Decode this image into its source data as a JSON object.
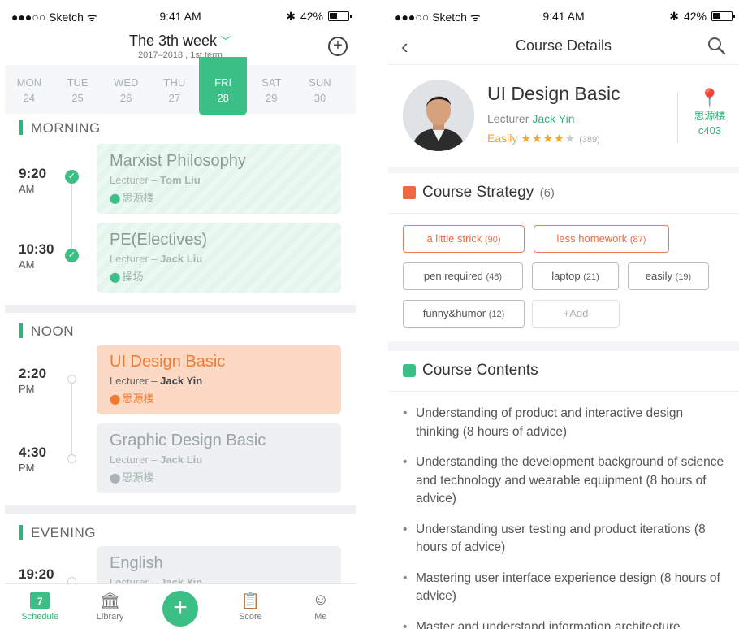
{
  "status": {
    "carrier": "●●●○○ Sketch ᯤ",
    "time": "9:41 AM",
    "bt": "✱",
    "battery": "42%"
  },
  "schedule": {
    "week_title": "The 3th week",
    "term": "2017–2018 , 1st term",
    "days": [
      {
        "d": "MON",
        "n": "24"
      },
      {
        "d": "TUE",
        "n": "25"
      },
      {
        "d": "WED",
        "n": "26"
      },
      {
        "d": "THU",
        "n": "27"
      },
      {
        "d": "FRI",
        "n": "28"
      },
      {
        "d": "SAT",
        "n": "29"
      },
      {
        "d": "SUN",
        "n": "30"
      }
    ],
    "sections": {
      "morning": "MORNING",
      "noon": "NOON",
      "evening": "EVENING"
    },
    "classes": [
      {
        "time": "9:20",
        "ampm": "AM",
        "name": "Marxist Philosophy",
        "lecturer_label": "Lecturer – ",
        "lecturer": "Tom Liu",
        "location": "思源楼"
      },
      {
        "time": "10:30",
        "ampm": "AM",
        "name": "PE(Electives)",
        "lecturer_label": "Lecturer – ",
        "lecturer": "Jack Liu",
        "location": "操场"
      },
      {
        "time": "2:20",
        "ampm": "PM",
        "name": "UI Design Basic",
        "lecturer_label": "Lecturer – ",
        "lecturer": "Jack Yin",
        "location": "思源楼"
      },
      {
        "time": "4:30",
        "ampm": "PM",
        "name": "Graphic Design Basic",
        "lecturer_label": "Lecturer – ",
        "lecturer": "Jack Liu",
        "location": "思源楼"
      },
      {
        "time": "19:20",
        "ampm": "PM",
        "name": "English",
        "lecturer_label": "Lecturer – ",
        "lecturer": "Jack Yin",
        "location": ""
      }
    ],
    "tabs": {
      "schedule": "Schedule",
      "calendar_day": "7",
      "library": "Library",
      "score": "Score",
      "me": "Me"
    }
  },
  "details": {
    "nav_title": "Course Details",
    "course_name": "UI Design Basic",
    "lecturer_label": "Lecturer",
    "lecturer": "Jack Yin",
    "difficulty": "Easily",
    "rating": 4,
    "rating_count": "(389)",
    "building": "思源楼",
    "room": "c403",
    "strategy_title": "Course Strategy",
    "strategy_count": "(6)",
    "tags": [
      {
        "label": "a little strick",
        "count": "(90)"
      },
      {
        "label": "less homework",
        "count": "(87)"
      },
      {
        "label": "pen required",
        "count": "(48)"
      },
      {
        "label": "laptop",
        "count": "(21)"
      },
      {
        "label": "easily",
        "count": "(19)"
      },
      {
        "label": "funny&humor",
        "count": "(12)"
      }
    ],
    "add_tag": "+Add",
    "contents_title": "Course Contents",
    "contents": [
      "Understanding of product and interactive design thinking (8 hours of advice)",
      "Understanding the development background of science and technology and wearable equipment (8 hours of advice)",
      "Understanding user testing and product iterations (8 hours of advice)",
      "Mastering user interface experience design (8 hours of advice)",
      "Master and understand information architecture"
    ]
  },
  "colors": {
    "accent": "#3cbf86",
    "current": "#f07a32",
    "hot_tag": "#ef6a3f"
  }
}
